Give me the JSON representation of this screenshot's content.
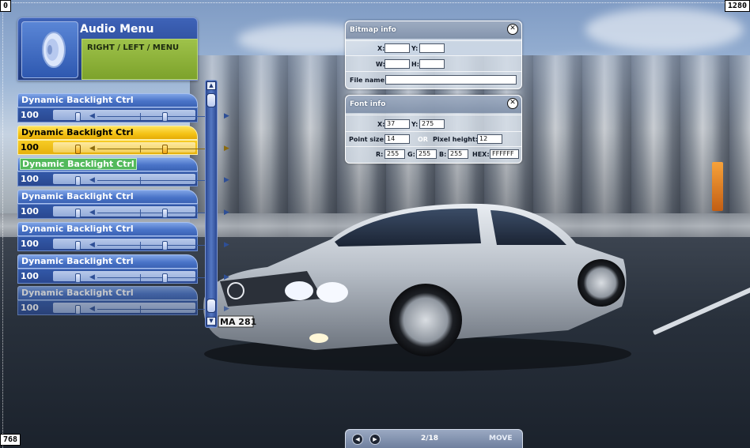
{
  "coordinates": {
    "top_left": "0",
    "top_right": "1280",
    "bottom_left": "768"
  },
  "audio_menu": {
    "title": "Audio Menu",
    "subtitle": "RIGHT / LEFT / MENU",
    "controls": [
      {
        "label": "Dynamic Backlight Ctrl",
        "value": "100",
        "state": "normal"
      },
      {
        "label": "Dynamic Backlight Ctrl",
        "value": "100",
        "state": "active"
      },
      {
        "label": "Dynamic Backlight Ctrl",
        "value": "100",
        "state": "highlighted"
      },
      {
        "label": "Dynamic Backlight Ctrl",
        "value": "100",
        "state": "normal"
      },
      {
        "label": "Dynamic Backlight Ctrl",
        "value": "100",
        "state": "normal"
      },
      {
        "label": "Dynamic Backlight Ctrl",
        "value": "100",
        "state": "normal"
      },
      {
        "label": "Dynamic Backlight Ctrl",
        "value": "100",
        "state": "faded"
      }
    ]
  },
  "bitmap_info": {
    "title": "Bitmap info",
    "x_label": "X:",
    "x_value": "",
    "y_label": "Y:",
    "y_value": "",
    "w_label": "W:",
    "w_value": "",
    "h_label": "H:",
    "h_value": "",
    "file_label": "File name:",
    "file_value": ""
  },
  "font_info": {
    "title": "Font info",
    "x_label": "X:",
    "x_value": "37",
    "y_label": "Y:",
    "y_value": "275",
    "point_size_label": "Point size:",
    "point_size_value": "14",
    "or_label": "OR",
    "pixel_height_label": "Pixel height:",
    "pixel_height_value": "12",
    "r_label": "R:",
    "r_value": "255",
    "g_label": "G:",
    "g_value": "255",
    "b_label": "B:",
    "b_value": "255",
    "hex_label": "HEX:",
    "hex_value": "FFFFFF"
  },
  "car": {
    "plate": "MA 281"
  },
  "bottom_nav": {
    "page": "2/18",
    "mode": "MOVE",
    "prev_icon": "prev-arrow-icon",
    "next_icon": "next-arrow-icon"
  },
  "colors": {
    "menu_blue": "#3b62b4",
    "active_yellow": "#f4c213",
    "highlight_green": "#52b95b",
    "subtitle_green": "#7da22b"
  }
}
